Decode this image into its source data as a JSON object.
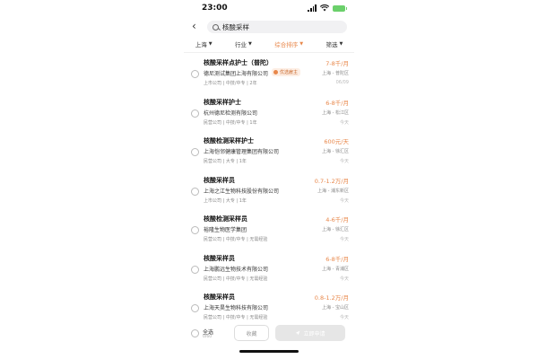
{
  "status": {
    "time": "23:00"
  },
  "search": {
    "query": "核酸采样"
  },
  "filters": [
    {
      "label": "上海",
      "active": false
    },
    {
      "label": "行业",
      "active": false
    },
    {
      "label": "综合排序",
      "active": true
    },
    {
      "label": "筛选",
      "active": false
    }
  ],
  "jobs": [
    {
      "title": "核酸采样点护士（普陀）",
      "salary": "7-8千/月",
      "company": "德尼测试集团上海有限公司",
      "badge": "优选雇主",
      "location": "上海 - 普陀区",
      "tags": "上市公司 | 中技/中专 | 2年",
      "date": "06/09"
    },
    {
      "title": "核酸采样护士",
      "salary": "6-8千/月",
      "company": "杭州德尼检测有限公司",
      "badge": "",
      "location": "上海 - 松江区",
      "tags": "民营公司 | 中技/中专 | 1年",
      "date": "今天"
    },
    {
      "title": "核酸检测采样护士",
      "salary": "600元/天",
      "company": "上海恺邻健康管理集团有限公司",
      "badge": "",
      "location": "上海 - 徐汇区",
      "tags": "民营公司 | 大专 | 1年",
      "date": "今天"
    },
    {
      "title": "核酸采样员",
      "salary": "0.7-1.2万/月",
      "company": "上海之江生物科技股份有限公司",
      "badge": "",
      "location": "上海 - 浦东新区",
      "tags": "上市公司 | 大专 | 1年",
      "date": "今天"
    },
    {
      "title": "核酸检测采样员",
      "salary": "4-6千/月",
      "company": "裕隆生物医学集团",
      "badge": "",
      "location": "上海 - 徐汇区",
      "tags": "民营公司 | 中技/中专 | 无需经验",
      "date": "今天"
    },
    {
      "title": "核酸采样员",
      "salary": "6-8千/月",
      "company": "上海鹏远生物技术有限公司",
      "badge": "",
      "location": "上海 - 青浦区",
      "tags": "民营公司 | 中技/中专 | 无需经验",
      "date": "今天"
    },
    {
      "title": "核酸采样员",
      "salary": "0.8-1.2万/月",
      "company": "上海天昊生物科技有限公司",
      "badge": "",
      "location": "上海 - 宝山区",
      "tags": "民营公司 | 中技/中专 | 无需经验",
      "date": "今天"
    }
  ],
  "bottom": {
    "select_all": "全选",
    "count": "0/60",
    "favorite": "收藏",
    "apply": "立即申请"
  },
  "colors": {
    "accent": "#e8874a",
    "badge_bg": "#fdeee4",
    "button_disabled": "#e6e6e6"
  }
}
